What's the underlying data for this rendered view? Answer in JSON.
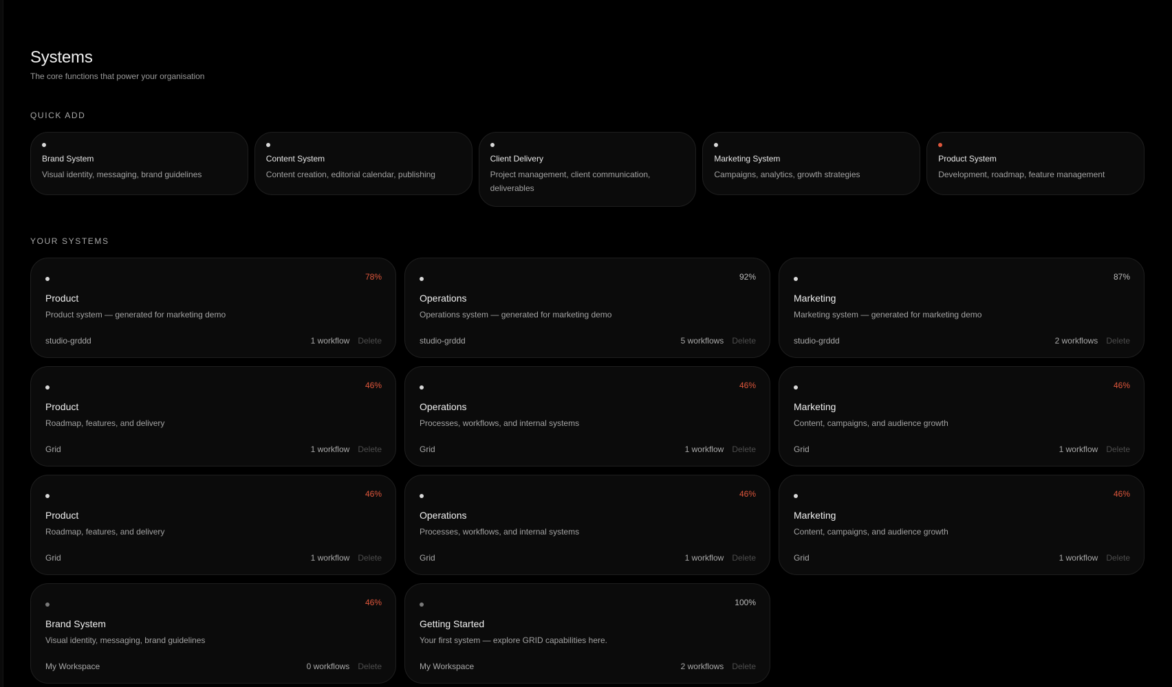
{
  "page": {
    "title": "Systems",
    "subtitle": "The core functions that power your organisation"
  },
  "colors": {
    "accent": "#e0573c",
    "background": "#000000",
    "card": "#0b0b0b"
  },
  "quick_add": {
    "label": "QUICK ADD",
    "items": [
      {
        "name": "Brand System",
        "desc": "Visual identity, messaging, brand guidelines",
        "dot": "#d9d9d9"
      },
      {
        "name": "Content System",
        "desc": "Content creation, editorial calendar, publishing",
        "dot": "#d9d9d9"
      },
      {
        "name": "Client Delivery",
        "desc": "Project management, client communication, deliverables",
        "dot": "#d9d9d9"
      },
      {
        "name": "Marketing System",
        "desc": "Campaigns, analytics, growth strategies",
        "dot": "#d9d9d9"
      },
      {
        "name": "Product System",
        "desc": "Development, roadmap, feature management",
        "dot": "#e0573c"
      }
    ]
  },
  "your_systems": {
    "label": "YOUR SYSTEMS",
    "delete_label": "Delete",
    "items": [
      {
        "name": "Product",
        "desc": "Product system — generated for marketing demo",
        "owner": "studio-grddd",
        "workflows": "1 workflow",
        "pct": "78%",
        "warn": true,
        "dim": false
      },
      {
        "name": "Operations",
        "desc": "Operations system — generated for marketing demo",
        "owner": "studio-grddd",
        "workflows": "5 workflows",
        "pct": "92%",
        "warn": false,
        "dim": false
      },
      {
        "name": "Marketing",
        "desc": "Marketing system — generated for marketing demo",
        "owner": "studio-grddd",
        "workflows": "2 workflows",
        "pct": "87%",
        "warn": false,
        "dim": false
      },
      {
        "name": "Product",
        "desc": "Roadmap, features, and delivery",
        "owner": "Grid",
        "workflows": "1 workflow",
        "pct": "46%",
        "warn": true,
        "dim": false
      },
      {
        "name": "Operations",
        "desc": "Processes, workflows, and internal systems",
        "owner": "Grid",
        "workflows": "1 workflow",
        "pct": "46%",
        "warn": true,
        "dim": false
      },
      {
        "name": "Marketing",
        "desc": "Content, campaigns, and audience growth",
        "owner": "Grid",
        "workflows": "1 workflow",
        "pct": "46%",
        "warn": true,
        "dim": false
      },
      {
        "name": "Product",
        "desc": "Roadmap, features, and delivery",
        "owner": "Grid",
        "workflows": "1 workflow",
        "pct": "46%",
        "warn": true,
        "dim": false
      },
      {
        "name": "Operations",
        "desc": "Processes, workflows, and internal systems",
        "owner": "Grid",
        "workflows": "1 workflow",
        "pct": "46%",
        "warn": true,
        "dim": false
      },
      {
        "name": "Marketing",
        "desc": "Content, campaigns, and audience growth",
        "owner": "Grid",
        "workflows": "1 workflow",
        "pct": "46%",
        "warn": true,
        "dim": false
      },
      {
        "name": "Brand System",
        "desc": "Visual identity, messaging, brand guidelines",
        "owner": "My Workspace",
        "workflows": "0 workflows",
        "pct": "46%",
        "warn": true,
        "dim": true
      },
      {
        "name": "Getting Started",
        "desc": "Your first system — explore GRID capabilities here.",
        "owner": "My Workspace",
        "workflows": "2 workflows",
        "pct": "100%",
        "warn": false,
        "dim": true
      }
    ]
  }
}
